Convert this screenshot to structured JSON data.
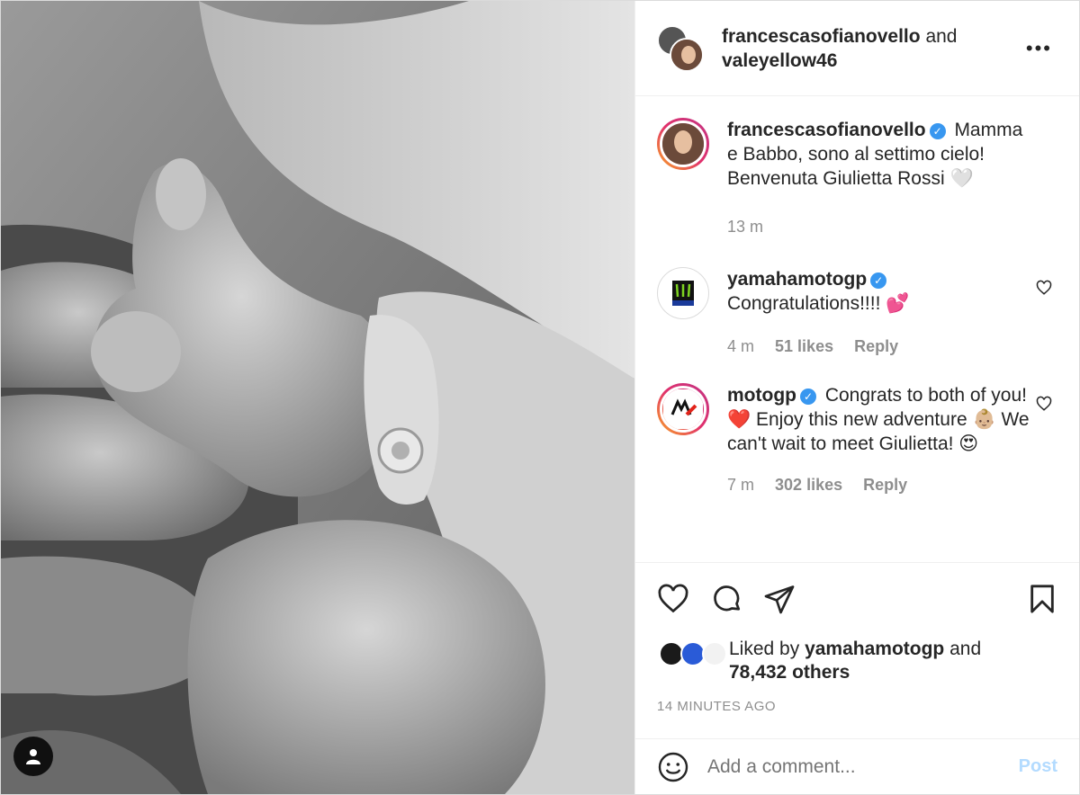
{
  "header": {
    "user1": "francescasofianovello",
    "joiner": "and",
    "user2": "valeyellow46",
    "more_label": "•••"
  },
  "caption": {
    "username": "francescasofianovello",
    "text": "Mamma e Babbo, sono al settimo cielo! Benvenuta Giulietta Rossi 🤍",
    "time": "13 m"
  },
  "comments": [
    {
      "username": "yamahamotogp",
      "text": "Congratulations!!!! 💕",
      "time": "4 m",
      "likes": "51 likes",
      "reply": "Reply"
    },
    {
      "username": "motogp",
      "text": "Congrats to both of you! ❤️ Enjoy this new adventure 👶🏼 We can't wait to meet Giulietta! 😍",
      "time": "7 m",
      "likes": "302 likes",
      "reply": "Reply"
    }
  ],
  "liked_by": {
    "prefix": "Liked by",
    "user": "yamahamotogp",
    "joiner": "and",
    "others": "78,432 others"
  },
  "time_ago": "14 MINUTES AGO",
  "add_comment": {
    "placeholder": "Add a comment...",
    "post_label": "Post"
  },
  "icons": {
    "like": "heart-icon",
    "comment": "comment-icon",
    "share": "paper-plane-icon",
    "save": "bookmark-icon",
    "emoji": "emoji-icon",
    "tagged": "user-icon"
  },
  "colors": {
    "verified": "#3897f0",
    "muted": "#8e8e8e",
    "post_disabled": "#b3dbff",
    "border": "#dbdbdb"
  }
}
